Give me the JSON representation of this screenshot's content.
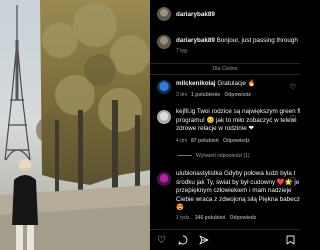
{
  "post": {
    "author": "dariarybak89",
    "author_comment": {
      "username": "dariarybak89",
      "text": "Bonjour, just passing through",
      "time": "7 tyg."
    },
    "for_you_label": "Dla Ciebie"
  },
  "comments": [
    {
      "username": "milckenikolaj",
      "text": "Gratulacje",
      "emoji": "🔥",
      "time": "3 dni",
      "likes": "1 polubienie",
      "reply": "Odpowiedz"
    },
    {
      "username": "",
      "lines": [
        "kejfil.ig Twoi rodzice są największym green fl",
        "programu! 😊 jak to miło zobaczyć w telewi",
        "zdrowe relacje w rodzinie ❤"
      ],
      "time": "4 dni",
      "likes": "87 polubień",
      "reply": "Odpowiedz",
      "view_replies": "Wyświetl odpowiedzi (1)"
    },
    {
      "username": "",
      "lines": [
        "ulubionastylistka Gdyby połowa ludzi była t",
        "środku jak Ty, świat by był cudowny ❤️🌟 je",
        "przepięknym człowiekiem i mam nadzieje",
        "Ciebie wraca z zdwojoną siłą Piękna babecz",
        "😍"
      ],
      "time": "1 tydz.",
      "likes": "346 polubień",
      "reply": "Odpowiedz"
    }
  ],
  "actions": {
    "like_icon": "♡",
    "comment_icon": "💬",
    "share_icon": "➤",
    "save_icon": "🔖"
  }
}
